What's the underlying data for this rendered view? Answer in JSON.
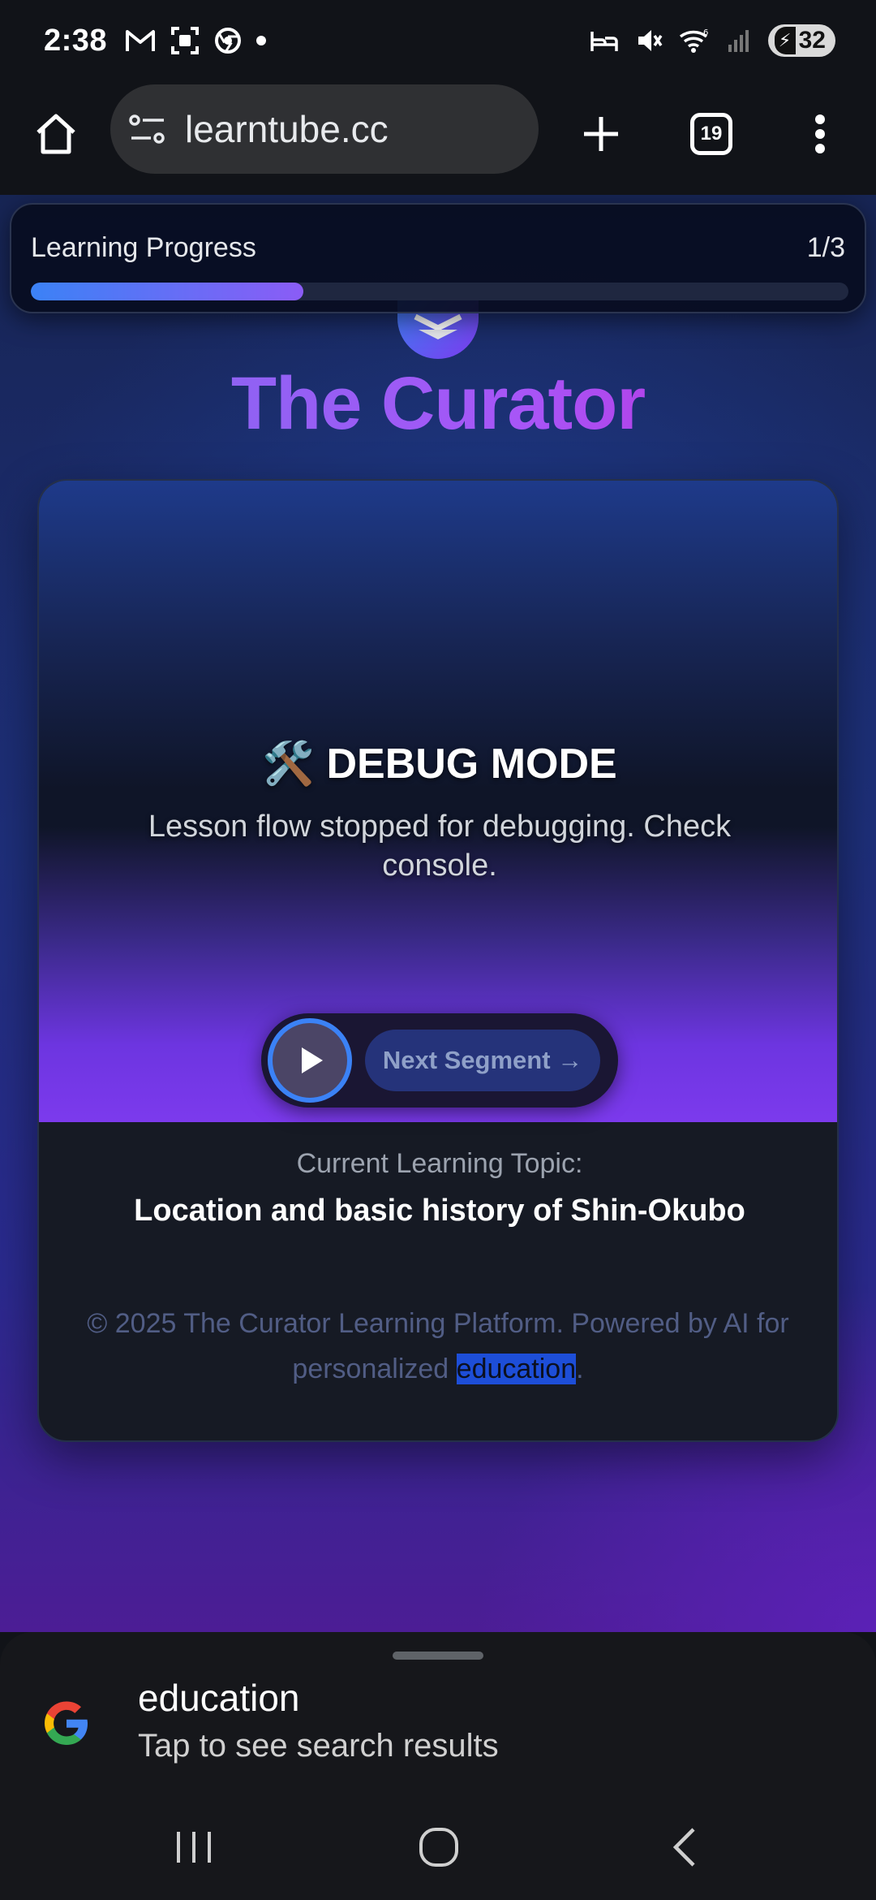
{
  "status_bar": {
    "time": "2:38",
    "battery": "32",
    "left_icons": [
      "gmail-icon",
      "screenshot-icon",
      "chrome-icon",
      "dot-icon"
    ],
    "right_icons": [
      "sleep-icon",
      "mute-icon",
      "wifi-icon",
      "signal-icon",
      "battery-icon"
    ]
  },
  "browser": {
    "url": "learntube.cc",
    "tab_count": "19"
  },
  "progress": {
    "label": "Learning Progress",
    "count": "1/3",
    "fraction": 0.333
  },
  "app": {
    "title": "The Curator"
  },
  "lesson": {
    "debug_icon": "🛠️",
    "debug_title": "DEBUG MODE",
    "debug_message": "Lesson flow stopped for debugging. Check console.",
    "next_label": "Next Segment →",
    "topic_label": "Current Learning Topic:",
    "topic_title": "Location and basic history of Shin-Okubo"
  },
  "footer": {
    "text_before": "© 2025 The Curator Learning Platform. Powered by AI for personalized ",
    "highlight": "education",
    "text_after": "."
  },
  "search_sheet": {
    "query": "education",
    "hint": "Tap to see search results"
  },
  "colors": {
    "accent_blue": "#3b82f6",
    "accent_purple": "#8b5cf6",
    "title_gradient_end": "#c026d3"
  }
}
